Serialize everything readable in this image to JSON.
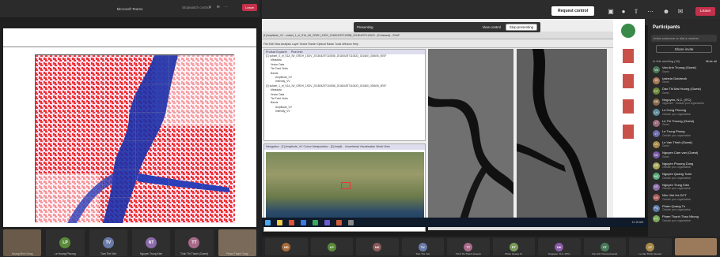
{
  "left_window": {
    "title": "Microsoft Teams",
    "toolbar_text": "Stopwatch control",
    "leave_label": "Leave",
    "video_tiles": [
      {
        "initials": "",
        "name": "Hoang Minh Dung",
        "color": "#7a5a3a"
      },
      {
        "initials": "LP",
        "name": "Le Hoang Phuong",
        "color": "#5a8a3a"
      },
      {
        "initials": "TV",
        "name": "Tran The Viet",
        "color": "#6a7aa8"
      },
      {
        "initials": "NT",
        "name": "Nguyen Trung Kien",
        "color": "#8a6aa8"
      },
      {
        "initials": "TT",
        "name": "Trinh Thi Thanh (Guest)",
        "color": "#a86a8a"
      },
      {
        "initials": "",
        "name": "Pham Thanh Tung",
        "color": "#9a7a5a"
      }
    ]
  },
  "meeting_bar": {
    "request_control": "Request control",
    "leave_label": "Leave",
    "presenting_label": "Presenting",
    "view_control": "View control",
    "stop_presenting": "Stop presenting"
  },
  "snap_app": {
    "window_title": "[1] Amplitude_VV - subset_1_of_S1A_IW_GRDH_1SDV_20180429T110558_20180429T110623 - [S:\\dataset] - SNAP",
    "menu": "File  Edit  View  Analysis  Layer  Vector  Raster  Optical  Radar  Tools  Window  Help",
    "product_explorer_tab": "Product Explorer",
    "pixel_info_tab": "Pixel Info",
    "tree": [
      "[1] subset_0_of_S1A_IW_GRDH_1SDV_20180429T110558_20180429T110623_021660_025605_0E0F",
      "Metadata",
      "Vector Data",
      "Tie-Point Grids",
      "Bands",
      "Amplitude_VV",
      "Intensity_VV",
      "[2] subset_1_of_S1A_IW_GRDH_1SDV_20180429T110558_20180429T110623_021660_025605_0E0F",
      "Metadata",
      "Vector Data",
      "Tie-Point Grids",
      "Bands",
      "Amplitude_VV",
      "Intensity_VV"
    ],
    "nav_tabs": "Navigation - [1] Amplitude_VV   Colour Manipulation - [2] Amplit...   Uncertainty Visualisation   World View",
    "nav_footer": "UTF Model",
    "status": "Lon: -    Lat: -    Zoom level: -    Level: -"
  },
  "taskbar_time": "11:15 AM",
  "participants": {
    "title": "Participants",
    "invite_placeholder": "Invite someone or dial a number",
    "share_invite": "Share invite",
    "in_meeting": "In this meeting (18)",
    "mute_all": "Mute all",
    "people": [
      {
        "initials": "VA",
        "name": "Van Anh Truong (Guest)",
        "sub": "Guest",
        "color": "#4a7a5a"
      },
      {
        "initials": "IG",
        "name": "Izabela Gutdrezik",
        "sub": "Guest",
        "color": "#a87a5a"
      },
      {
        "initials": "DT",
        "name": "Dao Thi Mai Huong (Guest)",
        "sub": "Guest",
        "color": "#6a8a3a"
      },
      {
        "initials": "NN",
        "name": "Nnguyen, N.C. (ITC)",
        "sub": "Organizer · Outside your organisation",
        "color": "#8a6a4a"
      },
      {
        "initials": "LH",
        "name": "Le Hong Phuong",
        "sub": "Outside your organisation",
        "color": "#5a8a9a"
      },
      {
        "initials": "LT",
        "name": "Le Thi Thuong (Guest)",
        "sub": "Guest",
        "color": "#9a6a7a"
      },
      {
        "initials": "LT",
        "name": "Le Trung Phong",
        "sub": "Outside your organisation",
        "color": "#6a6aa8"
      },
      {
        "initials": "LV",
        "name": "Le Van Thinh (Guest)",
        "sub": "Guest",
        "color": "#a88a4a"
      },
      {
        "initials": "NC",
        "name": "Nguyen Cam van (Guest)",
        "sub": "Guest",
        "color": "#7a5aa8"
      },
      {
        "initials": "NP",
        "name": "Nguyen Phuong Dung",
        "sub": "Outside your organisation",
        "color": "#a8a85a"
      },
      {
        "initials": "NQ",
        "name": "Nguyen Quang Tuan",
        "sub": "Outside your organisation",
        "color": "#5aa87a"
      },
      {
        "initials": "NT",
        "name": "Nguyen Trung Kien",
        "sub": "Outside your organisation",
        "color": "#8a6aa8"
      },
      {
        "initials": "NV",
        "name": "Nhu Viet Ha DCT",
        "sub": "Outside your organisation",
        "color": "#a85a5a"
      },
      {
        "initials": "PQ",
        "name": "Pham Quang Tu",
        "sub": "Outside your organisation",
        "color": "#5a7aa8"
      },
      {
        "initials": "PT",
        "name": "Pham Thanh Thao Nhung",
        "sub": "Outside your organisation",
        "color": "#7aa85a"
      }
    ]
  },
  "bottom_tiles": [
    {
      "initials": "ND",
      "name": "",
      "color": "#a86a3a"
    },
    {
      "initials": "LP",
      "name": "",
      "color": "#5a8a3a"
    },
    {
      "initials": "NK",
      "name": "",
      "color": "#8a5a5a"
    },
    {
      "initials": "TV",
      "name": "Tran The Viet",
      "color": "#6a7aa8"
    },
    {
      "initials": "TT",
      "name": "Trinh Thi Thanh (Guest)",
      "color": "#a86a8a"
    },
    {
      "initials": "PT",
      "name": "Pham Quang Tu",
      "color": "#7a9a5a"
    },
    {
      "initials": "NK",
      "name": "Nnguyen, N.C. (ITC)",
      "color": "#8a5aa8"
    },
    {
      "initials": "VT",
      "name": "Van Anh Truong (Guest)",
      "color": "#4a7a5a"
    },
    {
      "initials": "LT",
      "name": "Le Van Thinh (Guest)",
      "color": "#a88a4a"
    },
    {
      "initials": "",
      "name": "",
      "color": "#9a7a5a"
    }
  ]
}
